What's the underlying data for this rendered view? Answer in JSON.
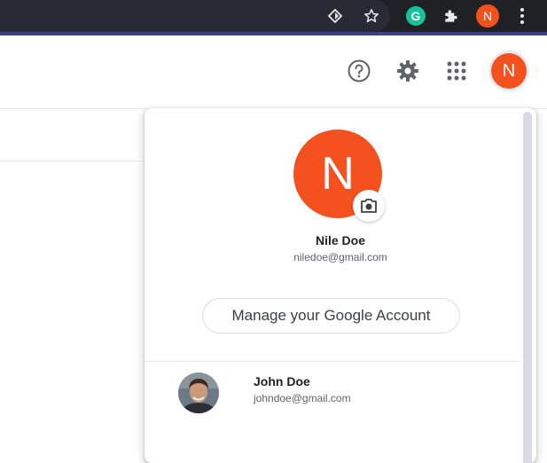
{
  "browser_toolbar": {
    "icons": [
      "reader-mode-icon",
      "bookmark-star-icon",
      "grammarly-extension-icon",
      "extensions-puzzle-icon",
      "profile-avatar",
      "chrome-menu-icon"
    ],
    "grammarly_letter": "G",
    "profile_initial": "N"
  },
  "app_header": {
    "icons": [
      "help-icon",
      "settings-gear-icon",
      "apps-grid-icon"
    ],
    "avatar_initial": "N"
  },
  "account_popup": {
    "avatar_initial": "N",
    "name": "Nile Doe",
    "email": "niledoe@gmail.com",
    "manage_button": "Manage your Google Account",
    "other_accounts": [
      {
        "name": "John Doe",
        "email": "johndoe@gmail.com"
      }
    ]
  },
  "colors": {
    "avatar_orange": "#f4511e",
    "chrome_dark": "#202124",
    "grammarly_green": "#15c39a"
  }
}
